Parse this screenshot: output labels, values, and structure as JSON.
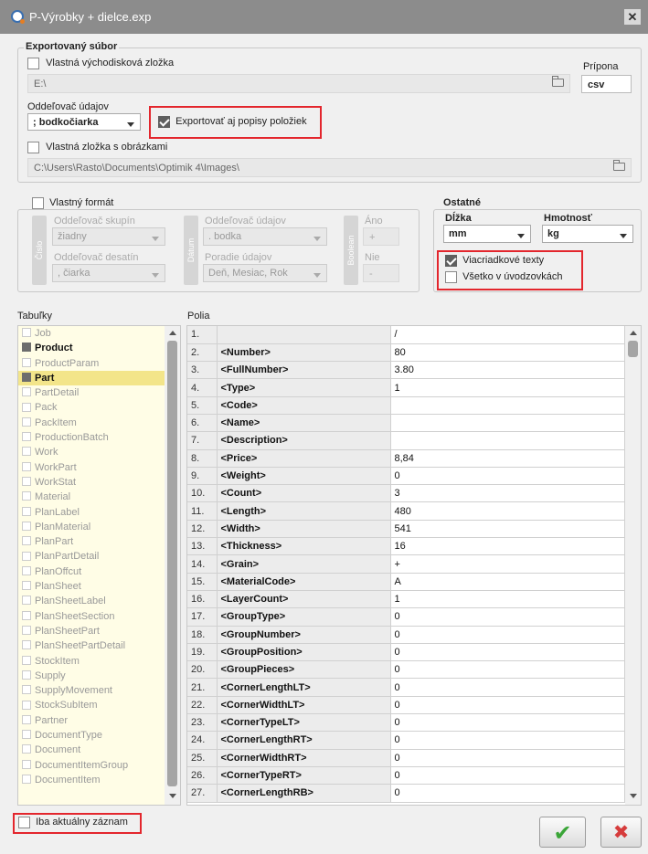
{
  "window": {
    "title": "P-Výrobky + dielce.exp",
    "close_glyph": "✕"
  },
  "export_file": {
    "group_label": "Exportovaný súbor",
    "custom_folder_label": "Vlastná východisková zložka",
    "custom_folder_checked": false,
    "folder_path": "E:\\",
    "extension_label": "Prípona",
    "extension_value": "csv",
    "separator_label": "Oddeľovač údajov",
    "separator_value": "; bodkočiarka",
    "export_descriptions_label": "Exportovať aj popisy položiek",
    "export_descriptions_checked": true,
    "images_folder_label": "Vlastná zložka s obrázkami",
    "images_folder_checked": false,
    "images_path": "C:\\Users\\Rasto\\Documents\\Optimik 4\\Images\\"
  },
  "custom_format": {
    "label": "Vlastný formát",
    "checked": false,
    "number_button": "Číslo",
    "group_separator_label": "Oddeľovač skupín",
    "group_separator_value": "žiadny",
    "decimal_separator_label": "Oddeľovač desatín",
    "decimal_separator_value": ", čiarka",
    "date_button": "Dátum",
    "date_separator_label": "Oddeľovač údajov",
    "date_separator_value": ". bodka",
    "date_order_label": "Poradie údajov",
    "date_order_value": "Deň, Mesiac, Rok",
    "boolean_button": "Boolean",
    "yes_label": "Áno",
    "yes_value": "+",
    "no_label": "Nie",
    "no_value": "-"
  },
  "other": {
    "label": "Ostatné",
    "length_label": "Dĺžka",
    "length_value": "mm",
    "weight_label": "Hmotnosť",
    "weight_value": "kg",
    "multiline_label": "Viacriadkové texty",
    "multiline_checked": true,
    "quotes_label": "Všetko v úvodzovkách",
    "quotes_checked": false
  },
  "tables": {
    "label": "Tabuľky",
    "items": [
      {
        "name": "Job",
        "checked": false
      },
      {
        "name": "Product",
        "checked": true
      },
      {
        "name": "ProductParam",
        "checked": false
      },
      {
        "name": "Part",
        "checked": true,
        "selected": true
      },
      {
        "name": "PartDetail",
        "checked": false
      },
      {
        "name": "Pack",
        "checked": false
      },
      {
        "name": "PackItem",
        "checked": false
      },
      {
        "name": "ProductionBatch",
        "checked": false
      },
      {
        "name": "Work",
        "checked": false
      },
      {
        "name": "WorkPart",
        "checked": false
      },
      {
        "name": "WorkStat",
        "checked": false
      },
      {
        "name": "Material",
        "checked": false
      },
      {
        "name": "PlanLabel",
        "checked": false
      },
      {
        "name": "PlanMaterial",
        "checked": false
      },
      {
        "name": "PlanPart",
        "checked": false
      },
      {
        "name": "PlanPartDetail",
        "checked": false
      },
      {
        "name": "PlanOffcut",
        "checked": false
      },
      {
        "name": "PlanSheet",
        "checked": false
      },
      {
        "name": "PlanSheetLabel",
        "checked": false
      },
      {
        "name": "PlanSheetSection",
        "checked": false
      },
      {
        "name": "PlanSheetPart",
        "checked": false
      },
      {
        "name": "PlanSheetPartDetail",
        "checked": false
      },
      {
        "name": "StockItem",
        "checked": false
      },
      {
        "name": "Supply",
        "checked": false
      },
      {
        "name": "SupplyMovement",
        "checked": false
      },
      {
        "name": "StockSubItem",
        "checked": false
      },
      {
        "name": "Partner",
        "checked": false
      },
      {
        "name": "DocumentType",
        "checked": false
      },
      {
        "name": "Document",
        "checked": false
      },
      {
        "name": "DocumentItemGroup",
        "checked": false
      },
      {
        "name": "DocumentItem",
        "checked": false
      }
    ]
  },
  "fields": {
    "label": "Polia",
    "rows": [
      {
        "num": "1.",
        "field": "",
        "value": "/"
      },
      {
        "num": "2.",
        "field": "<Number>",
        "value": "80"
      },
      {
        "num": "3.",
        "field": "<FullNumber>",
        "value": "3.80"
      },
      {
        "num": "4.",
        "field": "<Type>",
        "value": "1"
      },
      {
        "num": "5.",
        "field": "<Code>",
        "value": ""
      },
      {
        "num": "6.",
        "field": "<Name>",
        "value": ""
      },
      {
        "num": "7.",
        "field": "<Description>",
        "value": ""
      },
      {
        "num": "8.",
        "field": "<Price>",
        "value": "8,84"
      },
      {
        "num": "9.",
        "field": "<Weight>",
        "value": "0"
      },
      {
        "num": "10.",
        "field": "<Count>",
        "value": "3"
      },
      {
        "num": "11.",
        "field": "<Length>",
        "value": "480"
      },
      {
        "num": "12.",
        "field": "<Width>",
        "value": "541"
      },
      {
        "num": "13.",
        "field": "<Thickness>",
        "value": "16"
      },
      {
        "num": "14.",
        "field": "<Grain>",
        "value": "+"
      },
      {
        "num": "15.",
        "field": "<MaterialCode>",
        "value": "A"
      },
      {
        "num": "16.",
        "field": "<LayerCount>",
        "value": "1"
      },
      {
        "num": "17.",
        "field": "<GroupType>",
        "value": "0"
      },
      {
        "num": "18.",
        "field": "<GroupNumber>",
        "value": "0"
      },
      {
        "num": "19.",
        "field": "<GroupPosition>",
        "value": "0"
      },
      {
        "num": "20.",
        "field": "<GroupPieces>",
        "value": "0"
      },
      {
        "num": "21.",
        "field": "<CornerLengthLT>",
        "value": "0"
      },
      {
        "num": "22.",
        "field": "<CornerWidthLT>",
        "value": "0"
      },
      {
        "num": "23.",
        "field": "<CornerTypeLT>",
        "value": "0"
      },
      {
        "num": "24.",
        "field": "<CornerLengthRT>",
        "value": "0"
      },
      {
        "num": "25.",
        "field": "<CornerWidthRT>",
        "value": "0"
      },
      {
        "num": "26.",
        "field": "<CornerTypeRT>",
        "value": "0"
      },
      {
        "num": "27.",
        "field": "<CornerLengthRB>",
        "value": "0"
      }
    ]
  },
  "footer": {
    "current_record_label": "Iba aktuálny záznam",
    "current_record_checked": false,
    "ok_glyph": "✔",
    "cancel_glyph": "✖",
    "colors": {
      "ok": "#3aa537",
      "cancel": "#d63c3c",
      "highlight": "#e3262d",
      "selection": "#f3e58a"
    }
  }
}
